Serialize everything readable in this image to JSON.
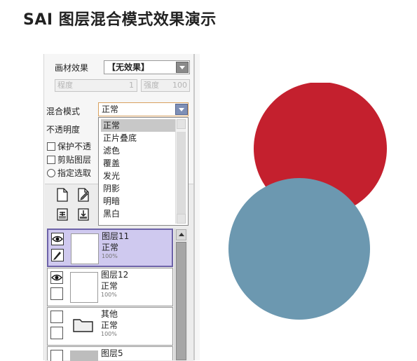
{
  "heading": "SAI 图层混合模式效果演示",
  "brush_effect": {
    "label": "画材效果",
    "value": "【无效果】"
  },
  "degree": {
    "label": "程度",
    "value": "1"
  },
  "strength": {
    "label": "强度",
    "value": "100"
  },
  "blend_mode": {
    "label": "混合模式",
    "value": "正常"
  },
  "opacity": {
    "label": "不透明度"
  },
  "options": {
    "protect": "保护不透",
    "clip": "剪贴图层",
    "select_source": "指定选取"
  },
  "blend_menu": [
    "正常",
    "正片叠底",
    "滤色",
    "覆盖",
    "发光",
    "阴影",
    "明暗",
    "黑白"
  ],
  "blend_menu_selected": "正常",
  "layers": [
    {
      "name": "图层11",
      "mode": "正常",
      "opacity": "100%"
    },
    {
      "name": "图层12",
      "mode": "正常",
      "opacity": "100%"
    },
    {
      "name": "其他",
      "mode": "正常",
      "opacity": "100%"
    },
    {
      "name": "图层5"
    }
  ],
  "colors": {
    "red_circle": "#c4202e",
    "blue_circle": "#6c98b0",
    "active_layer": "#cfc9ef"
  }
}
